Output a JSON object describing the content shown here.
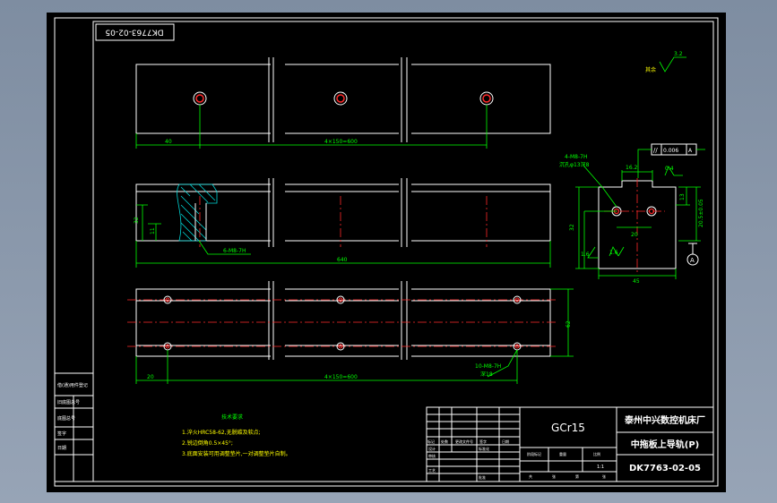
{
  "drawing_number_stamp": "DK7763-02-05",
  "material": "GCr15",
  "company": "泰州中兴数控机床厂",
  "part_name": "中拖板上导轨(P)",
  "drawing_number": "DK7763-02-05",
  "scale": "1:1",
  "roughness_other": "其余",
  "roughness_value": "3.2",
  "tech_requirements": {
    "title": "技术要求",
    "items": [
      "1.淬火HRC58-62,无脱碳及软点;",
      "2.锐边倒角0.5×45°;",
      "3.底面安装可用调整垫片,一对调整垫片自制。"
    ]
  },
  "front_view": {
    "dim_left": "40",
    "dim_pitch": "4×150=600"
  },
  "section_view": {
    "dim_height": "32",
    "dim_inner": "11",
    "callout": "6-M8-7H",
    "dim_length": "640"
  },
  "top_view": {
    "dim_width": "62",
    "dim_left": "20",
    "callout": "10-M8-7H",
    "callout_depth": "深18",
    "dim_pitch": "4×150=600"
  },
  "side_view": {
    "callout": "4-M8-7H",
    "callout_sub": "沉孔φ13深8",
    "tol_parallel": "0.006",
    "tol_datum": "A",
    "dim_top": "16.2",
    "dim_width": "45",
    "dim_depth": "32",
    "dim_inner": "20",
    "dim_right": "13",
    "dim_ht_fit": "20.5±0.05",
    "surface_value": "0.4",
    "rough_left": "1.6",
    "rough_right": "1.6",
    "datum_label": "A"
  },
  "side_panel": {
    "labels": [
      "借(通)用件登记",
      "旧底图总号",
      "底图总号",
      "签字",
      "日期"
    ]
  },
  "title_block": {
    "col_labels": [
      "标记",
      "处数",
      "更改文件号",
      "签字",
      "日期"
    ],
    "role_labels": [
      "设计",
      "标准化",
      "审核",
      "工艺",
      "批准"
    ],
    "stage_labels": [
      "阶段标记",
      "重量",
      "比例"
    ],
    "sheet_labels": [
      "共",
      "张",
      "第",
      "张"
    ]
  }
}
